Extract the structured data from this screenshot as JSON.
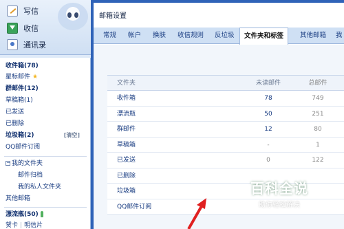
{
  "sidebar": {
    "actions": [
      {
        "label": "写信",
        "icon": "pencil-icon"
      },
      {
        "label": "收信",
        "icon": "inbox-arrow-icon"
      },
      {
        "label": "通讯录",
        "icon": "contacts-icon"
      }
    ],
    "folders": {
      "inbox": "收件箱(78)",
      "starred": "星标邮件",
      "group": "群邮件(12)",
      "drafts": "草稿箱(1)",
      "sent": "已发送",
      "deleted": "已删除",
      "spam": "垃圾箱(2)",
      "spam_clear": "[清空]",
      "subscription": "QQ邮件订阅",
      "my_folders": "我的文件夹",
      "archive": "邮件归档",
      "personal": "我的私人文件夹",
      "other": "其他邮箱",
      "drift": "漂流瓶(50)",
      "card": "贺卡",
      "postcard": "明信片"
    }
  },
  "main": {
    "title": "邮箱设置",
    "tabs": [
      "常规",
      "帐户",
      "换肤",
      "收信规则",
      "反垃圾",
      "文件夹和标签",
      "其他邮箱",
      "我"
    ],
    "active_tab_index": 5,
    "table": {
      "headers": {
        "name": "文件夹",
        "unread": "未读邮件",
        "total": "总邮件"
      },
      "rows": [
        {
          "name": "收件箱",
          "unread": "78",
          "total": "749"
        },
        {
          "name": "漂流瓶",
          "unread": "50",
          "total": "251"
        },
        {
          "name": "群邮件",
          "unread": "12",
          "total": "80"
        },
        {
          "name": "草稿箱",
          "unread": "-",
          "total": "1"
        },
        {
          "name": "已发送",
          "unread": "0",
          "total": "122"
        },
        {
          "name": "已删除",
          "unread": "",
          "total": ""
        },
        {
          "name": "垃圾箱",
          "unread": "",
          "total": ""
        },
        {
          "name": "QQ邮件订阅",
          "unread": "",
          "total": ""
        }
      ]
    }
  },
  "watermark": {
    "title": "百科全说",
    "subtitle": "助你轻松解决"
  },
  "colors": {
    "accent": "#2f63b8",
    "link": "#1a3d82",
    "tab_bar": "#cfe0f4"
  }
}
